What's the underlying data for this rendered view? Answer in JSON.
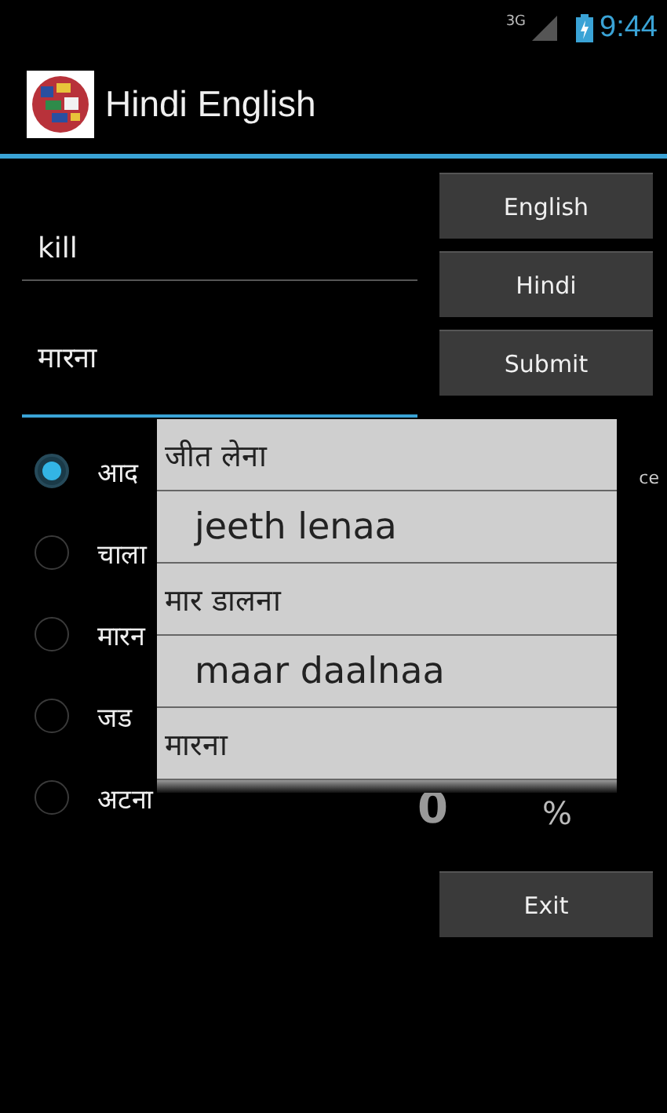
{
  "status_bar": {
    "network": "3G",
    "time": "9:44"
  },
  "action_bar": {
    "title": "Hindi English"
  },
  "fields": [
    {
      "value": "kill",
      "focused": false
    },
    {
      "value": "मारना",
      "focused": true
    }
  ],
  "buttons": [
    "English",
    "Hindi",
    "Submit"
  ],
  "radio_options": [
    {
      "label": "आद",
      "selected": true
    },
    {
      "label": "चाला",
      "selected": false
    },
    {
      "label": "मारन",
      "selected": false
    },
    {
      "label": "जड",
      "selected": false
    },
    {
      "label": "अटना",
      "selected": false
    }
  ],
  "side_text": "ce",
  "score": {
    "value": "0",
    "unit": "%"
  },
  "exit_button": "Exit",
  "suggestions": [
    {
      "text": "जीत लेना",
      "kind": "hindi"
    },
    {
      "text": "jeeth lenaa",
      "kind": "transliteration"
    },
    {
      "text": "मार डालना",
      "kind": "hindi"
    },
    {
      "text": "maar daalnaa",
      "kind": "transliteration"
    },
    {
      "text": "मारना",
      "kind": "hindi"
    }
  ]
}
